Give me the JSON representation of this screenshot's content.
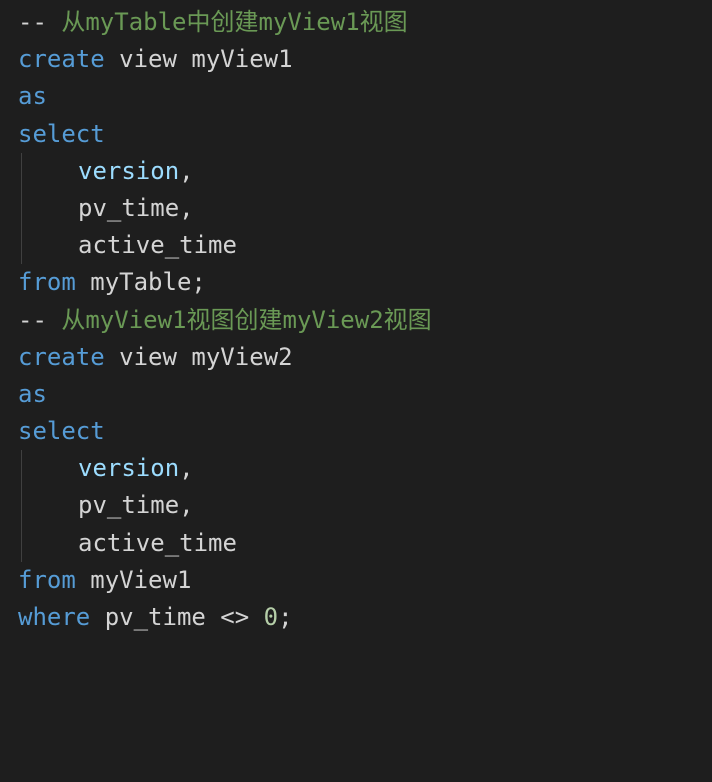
{
  "lines": [
    {
      "type": "comment",
      "dashes": "-- ",
      "text": "从myTable中创建myView1视图"
    },
    {
      "type": "create",
      "keyword": "create",
      "rest": " view myView1"
    },
    {
      "type": "keyword_only",
      "keyword": "as"
    },
    {
      "type": "keyword_only",
      "keyword": "select"
    },
    {
      "type": "indented_ident",
      "ident": "version",
      "suffix": ","
    },
    {
      "type": "indented_text",
      "text": "pv_time,"
    },
    {
      "type": "indented_text",
      "text": "active_time"
    },
    {
      "type": "from",
      "keyword": "from",
      "rest": " myTable;"
    },
    {
      "type": "comment",
      "dashes": "-- ",
      "text": "从myView1视图创建myView2视图"
    },
    {
      "type": "create",
      "keyword": "create",
      "rest": " view myView2"
    },
    {
      "type": "keyword_only",
      "keyword": "as"
    },
    {
      "type": "keyword_only",
      "keyword": "select"
    },
    {
      "type": "indented_ident",
      "ident": "version",
      "suffix": ","
    },
    {
      "type": "indented_text",
      "text": "pv_time,"
    },
    {
      "type": "indented_text",
      "text": "active_time"
    },
    {
      "type": "from",
      "keyword": "from",
      "rest": " myView1"
    },
    {
      "type": "where",
      "keyword": "where",
      "mid": " pv_time <> ",
      "num": "0",
      "suffix": ";"
    }
  ]
}
